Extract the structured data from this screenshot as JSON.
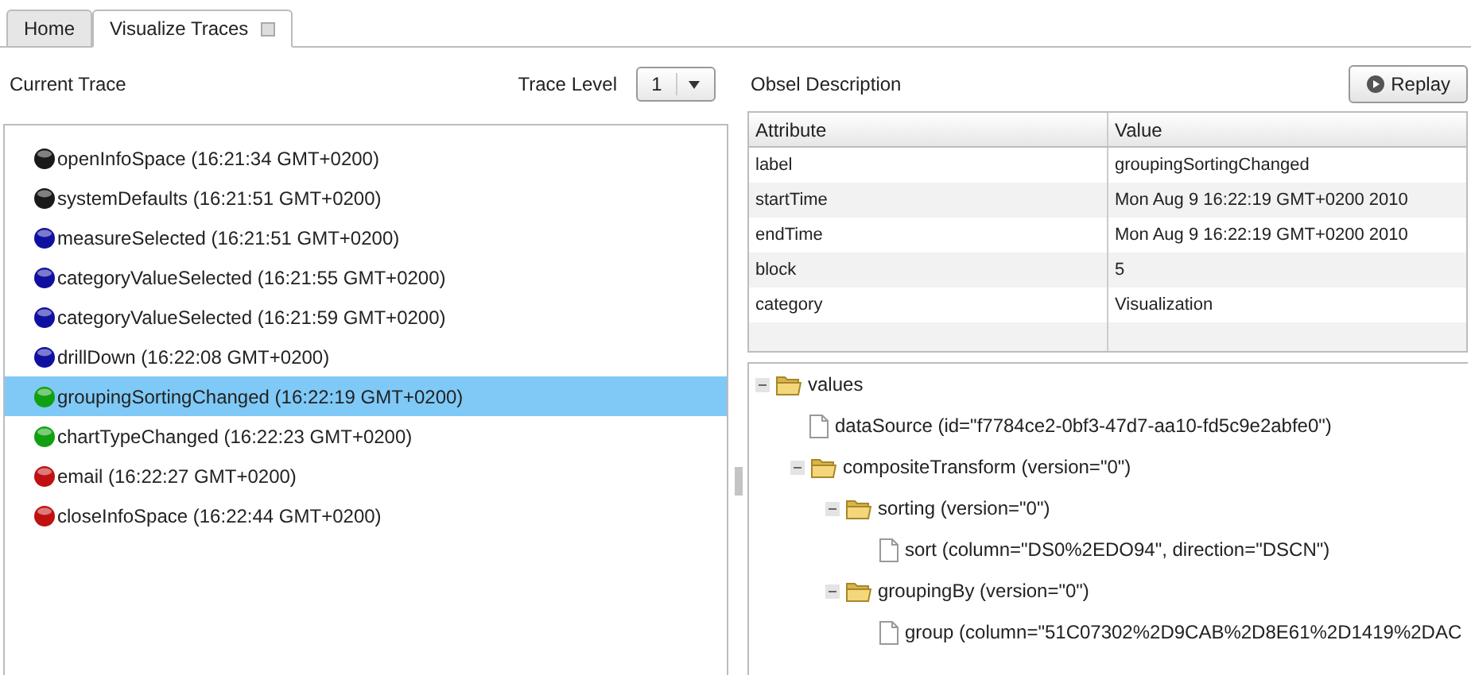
{
  "tabs": [
    {
      "label": "Home",
      "selected": false,
      "closable": false
    },
    {
      "label": "Visualize Traces",
      "selected": true,
      "closable": true
    }
  ],
  "trace_panel": {
    "title": "Current Trace",
    "level_label": "Trace Level",
    "level_value": "1",
    "events": [
      {
        "label": "openInfoSpace (16:21:34 GMT+0200)",
        "color": "#1a1a1a",
        "selected": false
      },
      {
        "label": "systemDefaults (16:21:51 GMT+0200)",
        "color": "#1a1a1a",
        "selected": false
      },
      {
        "label": "measureSelected (16:21:51 GMT+0200)",
        "color": "#1010a0",
        "selected": false
      },
      {
        "label": "categoryValueSelected (16:21:55 GMT+0200)",
        "color": "#1010a0",
        "selected": false
      },
      {
        "label": "categoryValueSelected (16:21:59 GMT+0200)",
        "color": "#1010a0",
        "selected": false
      },
      {
        "label": "drillDown (16:22:08 GMT+0200)",
        "color": "#1010a0",
        "selected": false
      },
      {
        "label": "groupingSortingChanged (16:22:19 GMT+0200)",
        "color": "#10a010",
        "selected": true
      },
      {
        "label": "chartTypeChanged (16:22:23 GMT+0200)",
        "color": "#10a010",
        "selected": false
      },
      {
        "label": "email (16:22:27 GMT+0200)",
        "color": "#c01010",
        "selected": false
      },
      {
        "label": "closeInfoSpace (16:22:44 GMT+0200)",
        "color": "#c01010",
        "selected": false
      }
    ]
  },
  "obsel_panel": {
    "title": "Obsel Description",
    "replay_button": "Replay",
    "table": {
      "columns": [
        "Attribute",
        "Value"
      ],
      "rows": [
        [
          "label",
          "groupingSortingChanged"
        ],
        [
          "startTime",
          "Mon Aug 9 16:22:19 GMT+0200 2010"
        ],
        [
          "endTime",
          "Mon Aug 9 16:22:19 GMT+0200 2010"
        ],
        [
          "block",
          "5"
        ],
        [
          "category",
          "Visualization"
        ]
      ]
    },
    "tree": [
      {
        "kind": "folder",
        "label": "values",
        "expanded": true,
        "children": [
          {
            "kind": "file",
            "label": "dataSource (id=\"f7784ce2-0bf3-47d7-aa10-fd5c9e2abfe0\")"
          },
          {
            "kind": "folder",
            "label": "compositeTransform (version=\"0\")",
            "expanded": true,
            "children": [
              {
                "kind": "folder",
                "label": "sorting (version=\"0\")",
                "expanded": true,
                "children": [
                  {
                    "kind": "file",
                    "label": "sort (column=\"DS0%2EDO94\", direction=\"DSCN\")"
                  }
                ]
              },
              {
                "kind": "folder",
                "label": "groupingBy (version=\"0\")",
                "expanded": true,
                "children": [
                  {
                    "kind": "file",
                    "label": "group (column=\"51C07302%2D9CAB%2D8E61%2D1419%2DAC"
                  }
                ]
              }
            ]
          }
        ]
      }
    ]
  }
}
